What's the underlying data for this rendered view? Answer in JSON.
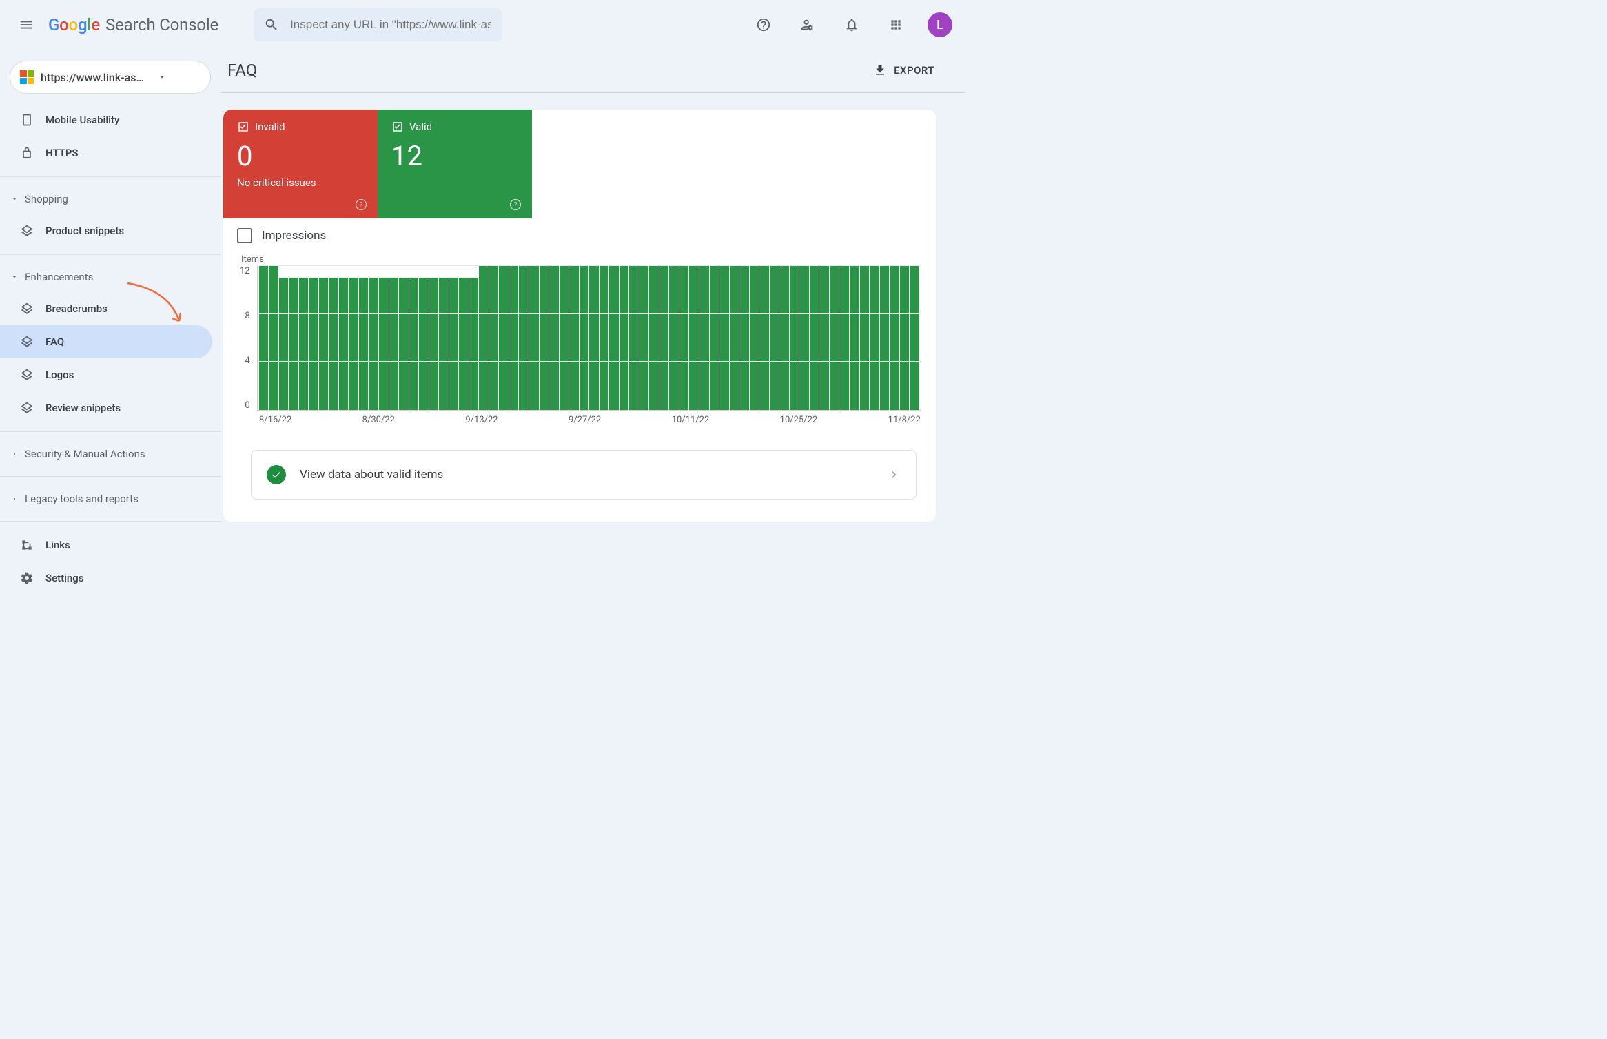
{
  "header": {
    "product_name": "Search Console",
    "search_placeholder": "Inspect any URL in \"https://www.link-assistant.com",
    "avatar_initial": "L"
  },
  "sidebar": {
    "property_label": "https://www.link-as…",
    "nav_top": [
      {
        "icon": "mobile-icon",
        "label": "Mobile Usability"
      },
      {
        "icon": "lock-icon",
        "label": "HTTPS"
      }
    ],
    "group_shopping": {
      "label": "Shopping",
      "items": [
        {
          "icon": "layers-icon",
          "label": "Product snippets"
        }
      ]
    },
    "group_enhancements": {
      "label": "Enhancements",
      "items": [
        {
          "icon": "layers-icon",
          "label": "Breadcrumbs"
        },
        {
          "icon": "layers-icon",
          "label": "FAQ",
          "active": true
        },
        {
          "icon": "layers-icon",
          "label": "Logos"
        },
        {
          "icon": "layers-icon",
          "label": "Review snippets"
        }
      ]
    },
    "group_security": {
      "label": "Security & Manual Actions"
    },
    "group_legacy": {
      "label": "Legacy tools and reports"
    },
    "nav_bottom": [
      {
        "icon": "links-icon",
        "label": "Links"
      },
      {
        "icon": "gear-icon",
        "label": "Settings"
      }
    ]
  },
  "page": {
    "title": "FAQ",
    "export_label": "EXPORT"
  },
  "summary": {
    "invalid": {
      "label": "Invalid",
      "count": "0",
      "sub": "No critical issues"
    },
    "valid": {
      "label": "Valid",
      "count": "12"
    }
  },
  "impressions": {
    "label": "Impressions",
    "checked": false
  },
  "view_data": {
    "label": "View data about valid items"
  },
  "chart_data": {
    "type": "bar",
    "title": "",
    "ylabel": "Items",
    "ylim": [
      0,
      12
    ],
    "yticks": [
      0,
      4,
      8,
      12
    ],
    "xticks": [
      "8/16/22",
      "8/30/22",
      "9/13/22",
      "9/27/22",
      "10/11/22",
      "10/25/22",
      "11/8/22"
    ],
    "values": [
      12,
      12,
      11,
      11,
      11,
      11,
      11,
      11,
      11,
      11,
      11,
      11,
      11,
      11,
      11,
      11,
      11,
      11,
      11,
      11,
      11,
      11,
      12,
      12,
      12,
      12,
      12,
      12,
      12,
      12,
      12,
      12,
      12,
      12,
      12,
      12,
      12,
      12,
      12,
      12,
      12,
      12,
      12,
      12,
      12,
      12,
      12,
      12,
      12,
      12,
      12,
      12,
      12,
      12,
      12,
      12,
      12,
      12,
      12,
      12,
      12,
      12,
      12,
      12,
      12,
      12
    ]
  }
}
